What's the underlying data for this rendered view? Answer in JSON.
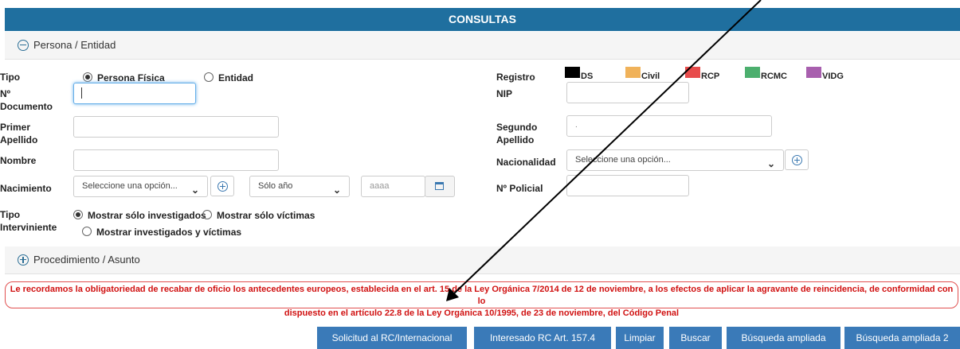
{
  "header": {
    "title": "CONSULTAS"
  },
  "section_persona": {
    "label": "Persona / Entidad"
  },
  "section_procedimiento": {
    "label": "Procedimiento / Asunto"
  },
  "form": {
    "tipo_label": "Tipo",
    "tipo_options": [
      "Persona Física",
      "Entidad"
    ],
    "documento_label": "Nº Documento",
    "documento_label_lines": [
      "Nº",
      "Documento"
    ],
    "primer_apellido_label_lines": [
      "Primer",
      "Apellido"
    ],
    "nombre_label": "Nombre",
    "nacimiento_label": "Nacimiento",
    "nacimiento_select": "Seleccione una opción...",
    "solo_anio_select": "Sólo año",
    "anio_placeholder": "aaaa",
    "tipo_interviniente_label_lines": [
      "Tipo",
      "Interviniente"
    ],
    "interviniente_options": [
      "Mostrar sólo investigados",
      "Mostrar sólo víctimas",
      "Mostrar investigados y víctimas"
    ],
    "registro_label": "Registro",
    "registros": [
      {
        "name": "DS",
        "color": "#000000"
      },
      {
        "name": "Civil",
        "color": "#f0b25a"
      },
      {
        "name": "RCP",
        "color": "#e84c4c"
      },
      {
        "name": "RCMC",
        "color": "#4caf6e"
      },
      {
        "name": "VIDG",
        "color": "#a85fae"
      }
    ],
    "nip_label": "NIP",
    "segundo_apellido_label_lines": [
      "Segundo",
      "Apellido"
    ],
    "segundo_apellido_value": ".",
    "nacionalidad_label": "Nacionalidad",
    "nacionalidad_select": "Seleccione una opción...",
    "policial_label": "Nº Policial"
  },
  "notice": {
    "line1": "Le recordamos la obligatoriedad de recabar de oficio los antecedentes europeos, establecida en el art. 15 de la Ley Orgánica 7/2014 de 12 de noviembre, a los efectos de aplicar la agravante de reincidencia, de conformidad con lo",
    "line2": "dispuesto en el artículo 22.8 de la Ley Orgánica 10/1995, de 23 de noviembre, del Código Penal"
  },
  "buttons": [
    "Solicitud al RC/Internacional",
    "Interesado RC Art. 157.4",
    "Limpiar",
    "Buscar",
    "Búsqueda ampliada",
    "Búsqueda ampliada 2"
  ]
}
